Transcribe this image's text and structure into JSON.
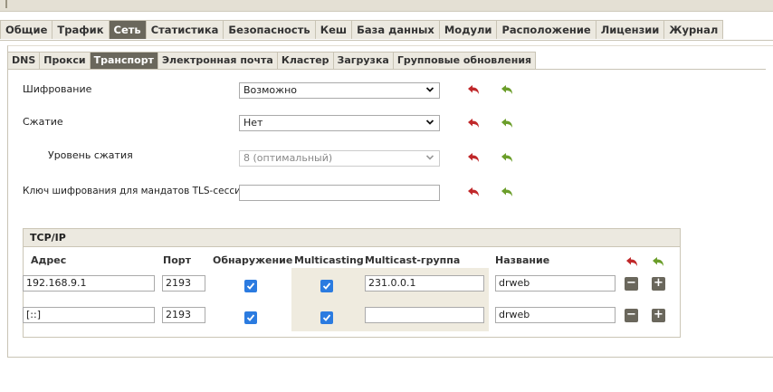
{
  "main_tabs": [
    {
      "label": "Общие",
      "active": false
    },
    {
      "label": "Трафик",
      "active": false
    },
    {
      "label": "Сеть",
      "active": true
    },
    {
      "label": "Статистика",
      "active": false
    },
    {
      "label": "Безопасность",
      "active": false
    },
    {
      "label": "Кеш",
      "active": false
    },
    {
      "label": "База данных",
      "active": false
    },
    {
      "label": "Модули",
      "active": false
    },
    {
      "label": "Расположение",
      "active": false
    },
    {
      "label": "Лицензии",
      "active": false
    },
    {
      "label": "Журнал",
      "active": false
    }
  ],
  "sub_tabs": [
    {
      "label": "DNS",
      "active": false
    },
    {
      "label": "Прокси",
      "active": false
    },
    {
      "label": "Транспорт",
      "active": true
    },
    {
      "label": "Электронная почта",
      "active": false
    },
    {
      "label": "Кластер",
      "active": false
    },
    {
      "label": "Загрузка",
      "active": false
    },
    {
      "label": "Групповые обновления",
      "active": false
    }
  ],
  "form": {
    "encryption": {
      "label": "Шифрование",
      "value": "Возможно"
    },
    "compression": {
      "label": "Сжатие",
      "value": "Нет"
    },
    "compression_level": {
      "label": "Уровень сжатия",
      "value": "8 (оптимальный)",
      "disabled": true
    },
    "tls_key": {
      "label": "Ключ шифрования для мандатов TLS-сессии",
      "value": ""
    }
  },
  "tcp": {
    "title": "TCP/IP",
    "columns": {
      "address": "Адрес",
      "port": "Порт",
      "discovery": "Обнаружение",
      "multicasting": "Multicasting",
      "multicast_group": "Multicast-группа",
      "name": "Название"
    },
    "rows": [
      {
        "address": "192.168.9.1",
        "port": "2193",
        "discovery": true,
        "multicasting": true,
        "multicast_group": "231.0.0.1",
        "name": "drweb"
      },
      {
        "address": "[::]",
        "port": "2193",
        "discovery": true,
        "multicasting": true,
        "multicast_group": "",
        "name": "drweb"
      }
    ],
    "remove_glyph": "−",
    "add_glyph": "+"
  },
  "colors": {
    "undo": "#c0282a",
    "redo": "#6b9e2a",
    "checkbox": "#2b7be0",
    "active_tab": "#6a675c"
  },
  "icons": {
    "undo": "undo-arrow-icon",
    "redo": "redo-arrow-icon",
    "select_arrow": "chevron-down-icon",
    "check": "check-icon"
  }
}
